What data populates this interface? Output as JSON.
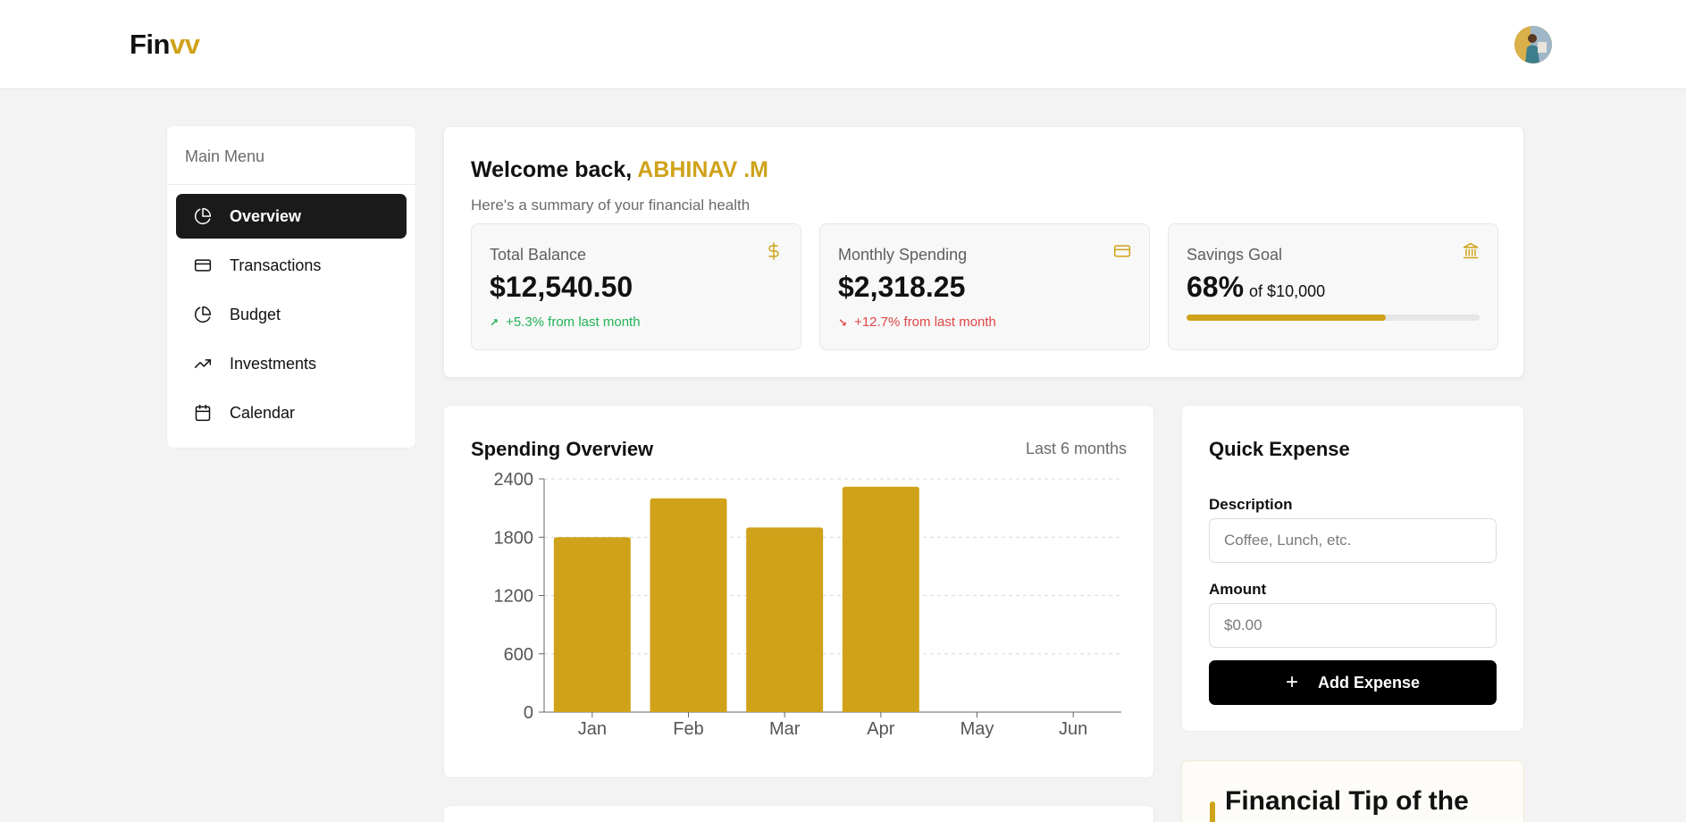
{
  "app": {
    "logo_main": "Fin",
    "logo_accent": "vv"
  },
  "colors": {
    "accent": "#cfa219",
    "positive": "#22b356",
    "negative": "#e04444",
    "dark": "#1a1a1a"
  },
  "sidebar": {
    "title": "Main Menu",
    "items": [
      {
        "label": "Overview",
        "icon": "pie-chart-icon",
        "active": true
      },
      {
        "label": "Transactions",
        "icon": "credit-card-icon"
      },
      {
        "label": "Budget",
        "icon": "pie-chart-icon"
      },
      {
        "label": "Investments",
        "icon": "trending-up-icon"
      },
      {
        "label": "Calendar",
        "icon": "calendar-icon"
      }
    ]
  },
  "welcome": {
    "greeting": "Welcome back,",
    "name": "ABHINAV .M",
    "subtitle": "Here's a summary of your financial health"
  },
  "stats": {
    "balance": {
      "label": "Total Balance",
      "value": "$12,540.50",
      "change": "+5.3% from last month",
      "icon": "dollar-icon"
    },
    "spending": {
      "label": "Monthly Spending",
      "value": "$2,318.25",
      "change": "+12.7% from last month",
      "icon": "credit-card-icon"
    },
    "savings": {
      "label": "Savings Goal",
      "value": "68%",
      "target": "of $10,000",
      "progress": 0.68,
      "icon": "bank-icon"
    }
  },
  "chart_card": {
    "title": "Spending Overview",
    "range": "Last 6 months"
  },
  "chart_data": {
    "type": "bar",
    "categories": [
      "Jan",
      "Feb",
      "Mar",
      "Apr",
      "May",
      "Jun"
    ],
    "values": [
      1800,
      2200,
      1900,
      2320,
      0,
      0
    ],
    "yticks": [
      0,
      600,
      1200,
      1800,
      2400
    ],
    "ylim": [
      0,
      2400
    ],
    "grid": true,
    "bar_color": "#cfa219"
  },
  "quick_expense": {
    "title": "Quick Expense",
    "description_label": "Description",
    "description_placeholder": "Coffee, Lunch, etc.",
    "amount_label": "Amount",
    "amount_placeholder": "$0.00",
    "button_label": "Add Expense"
  },
  "tip": {
    "title": "Financial Tip of the Day"
  }
}
